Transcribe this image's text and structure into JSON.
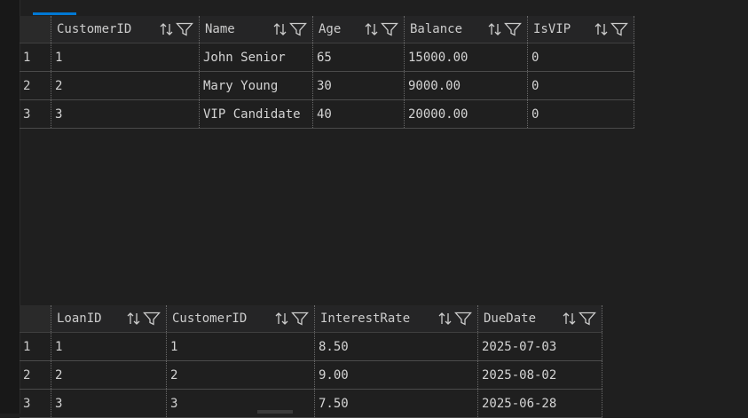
{
  "results": [
    {
      "columns": [
        "CustomerID",
        "Name",
        "Age",
        "Balance",
        "IsVIP"
      ],
      "rows": [
        {
          "num": "1",
          "cells": [
            "1",
            "John Senior",
            "65",
            "15000.00",
            "0"
          ]
        },
        {
          "num": "2",
          "cells": [
            "2",
            "Mary Young",
            "30",
            "9000.00",
            "0"
          ]
        },
        {
          "num": "3",
          "cells": [
            "3",
            "VIP Candidate",
            "40",
            "20000.00",
            "0"
          ]
        }
      ]
    },
    {
      "columns": [
        "LoanID",
        "CustomerID",
        "InterestRate",
        "DueDate"
      ],
      "rows": [
        {
          "num": "1",
          "cells": [
            "1",
            "1",
            "8.50",
            "2025-07-03"
          ]
        },
        {
          "num": "2",
          "cells": [
            "2",
            "2",
            "9.00",
            "2025-08-02"
          ]
        },
        {
          "num": "3",
          "cells": [
            "3",
            "3",
            "7.50",
            "2025-06-28"
          ]
        }
      ]
    }
  ],
  "colors": {
    "background": "#1f1f1f",
    "accent": "#0078d4",
    "text": "#d4d4d4"
  },
  "icons": [
    "sort-icon",
    "filter-icon"
  ]
}
